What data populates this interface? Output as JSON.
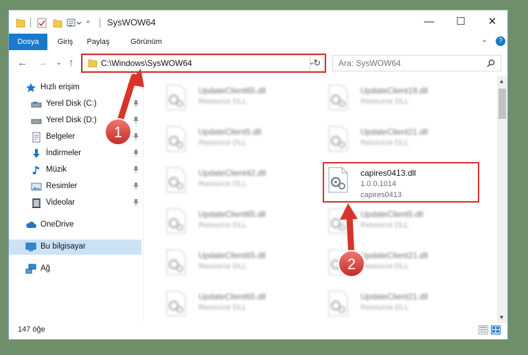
{
  "window": {
    "title": "SysWOW64",
    "minimize_glyph": "—",
    "maximize_glyph": "☐",
    "close_glyph": "✕"
  },
  "ribbon": {
    "tabs": [
      {
        "label": "Dosya",
        "active": true
      },
      {
        "label": "Giriş",
        "active": false
      },
      {
        "label": "Paylaş",
        "active": false
      },
      {
        "label": "Görünüm",
        "active": false
      }
    ],
    "expand_glyph": "⌄",
    "help_glyph": "?"
  },
  "address": {
    "path": "C:\\Windows\\SysWOW64",
    "dropdown_glyph": "⌄",
    "refresh_glyph": "↻"
  },
  "nav_buttons": {
    "back": "←",
    "forward": "→",
    "recent": "⌄",
    "up": "↑"
  },
  "search": {
    "placeholder": "Ara: SysWOW64",
    "icon": "search-icon"
  },
  "sidebar": {
    "items": [
      {
        "label": "Hızlı erişim",
        "icon": "star-icon"
      },
      {
        "label": "Yerel Disk (C:)",
        "icon": "drive-icon",
        "pinned": true
      },
      {
        "label": "Yerel Disk (D:)",
        "icon": "drive-icon",
        "pinned": true
      },
      {
        "label": "Belgeler",
        "icon": "documents-icon",
        "pinned": true
      },
      {
        "label": "İndirmeler",
        "icon": "download-icon",
        "pinned": true
      },
      {
        "label": "Müzik",
        "icon": "music-icon",
        "pinned": true
      },
      {
        "label": "Resimler",
        "icon": "pictures-icon",
        "pinned": true
      },
      {
        "label": "Videolar",
        "icon": "video-icon",
        "pinned": true
      },
      {
        "label": "OneDrive",
        "icon": "cloud-icon"
      },
      {
        "label": "Bu bilgisayar",
        "icon": "computer-icon",
        "selected": true
      },
      {
        "label": "Ağ",
        "icon": "network-icon"
      }
    ]
  },
  "files": [
    {
      "name": "UpdateClient65.dll",
      "line2": "Resource DLL",
      "line3": "",
      "blurred": true
    },
    {
      "name": "UpdateClient19.dll",
      "line2": "Resource DLL",
      "line3": "",
      "blurred": true
    },
    {
      "name": "UpdateClient5.dll",
      "line2": "Resource DLL",
      "line3": "",
      "blurred": true
    },
    {
      "name": "UpdateClient21.dll",
      "line2": "Resource DLL",
      "line3": "",
      "blurred": true
    },
    {
      "name": "UpdateClient42.dll",
      "line2": "Resource DLL",
      "line3": "",
      "blurred": true
    },
    {
      "name": "capires0413.dll",
      "line2": "1.0.0.1014",
      "line3": "capires0413",
      "blurred": false
    },
    {
      "name": "UpdateClient65.dll",
      "line2": "Resource DLL",
      "line3": "",
      "blurred": true
    },
    {
      "name": "UpdateClient5.dll",
      "line2": "Resource DLL",
      "line3": "",
      "blurred": true
    },
    {
      "name": "UpdateClient65.dll",
      "line2": "Resource DLL",
      "line3": "",
      "blurred": true
    },
    {
      "name": "UpdateClient21.dll",
      "line2": "Resource DLL",
      "line3": "",
      "blurred": true
    },
    {
      "name": "UpdateClient65.dll",
      "line2": "Resource DLL",
      "line3": "",
      "blurred": true
    },
    {
      "name": "UpdateClient21.dll",
      "line2": "Resource DLL",
      "line3": "",
      "blurred": true
    }
  ],
  "status": {
    "count": "147 öğe"
  },
  "annotations": {
    "step1": "1",
    "step2": "2"
  },
  "colors": {
    "accent": "#1979ca",
    "highlight": "#d72b2b",
    "selected": "#cce3f7"
  }
}
